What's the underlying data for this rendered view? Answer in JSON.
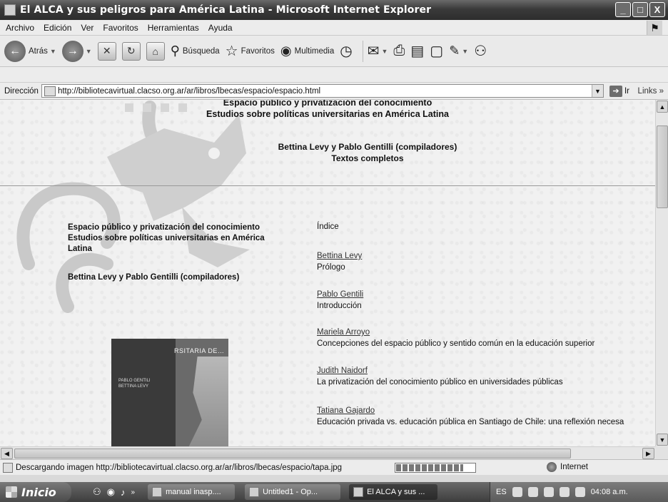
{
  "window": {
    "title": "El ALCA y sus peligros para América Latina - Microsoft Internet Explorer",
    "buttons": {
      "minimize": "_",
      "maximize": "□",
      "close": "X"
    }
  },
  "menu": [
    "Archivo",
    "Edición",
    "Ver",
    "Favoritos",
    "Herramientas",
    "Ayuda"
  ],
  "toolbar": {
    "back_label": "Atrás",
    "search_label": "Búsqueda",
    "favorites_label": "Favoritos",
    "multimedia_label": "Multimedia"
  },
  "address": {
    "label": "Dirección",
    "url": "http://bibliotecavirtual.clacso.org.ar/ar/libros/lbecas/espacio/espacio.html",
    "go_label": "Ir",
    "links_label": "Links"
  },
  "page": {
    "header_title_line1": "Espacio público y privatización del conocimiento",
    "header_title_line2": "Estudios sobre políticas universitarias en América Latina",
    "header_authors": "Bettina Levy y Pablo Gentilli (compiladores)",
    "header_texts": "Textos completos",
    "left_title_line1": "Espacio público y privatización del conocimiento",
    "left_title_line2": "Estudios sobre políticas universitarias en América",
    "left_title_line3": "Latina",
    "left_authors": "Bettina Levy y Pablo Gentilli (compiladores)",
    "index_label": "Índice",
    "cover_title": "RSITARIA DE…",
    "cover_authors_line1": "PABLO GENTILI",
    "cover_authors_line2": "BETTINA LEVY",
    "entries": [
      {
        "author": "Bettina Levy",
        "title": "Prólogo"
      },
      {
        "author": "Pablo Gentili",
        "title": "Introducción"
      },
      {
        "author": "Mariela Arroyo",
        "title": "Concepciones del espacio público y sentido común en la educación superior"
      },
      {
        "author": "Judith Naidorf",
        "title": "La privatización del conocimiento público en universidades públicas"
      },
      {
        "author": "Tatiana Gajardo",
        "title": "Educación privada vs. educación pública en Santiago de Chile: una reflexión necesa"
      }
    ]
  },
  "status": {
    "text": "Descargando imagen http://bibliotecavirtual.clacso.org.ar/ar/libros/lbecas/espacio/tapa.jpg",
    "zone": "Internet",
    "progress": 0.85
  },
  "taskbar": {
    "start_label": "Inicio",
    "tasks": [
      "manual inasp....",
      "Untitled1 - Op...",
      "El ALCA y sus ..."
    ],
    "lang": "ES",
    "clock": "04:08 a.m."
  }
}
